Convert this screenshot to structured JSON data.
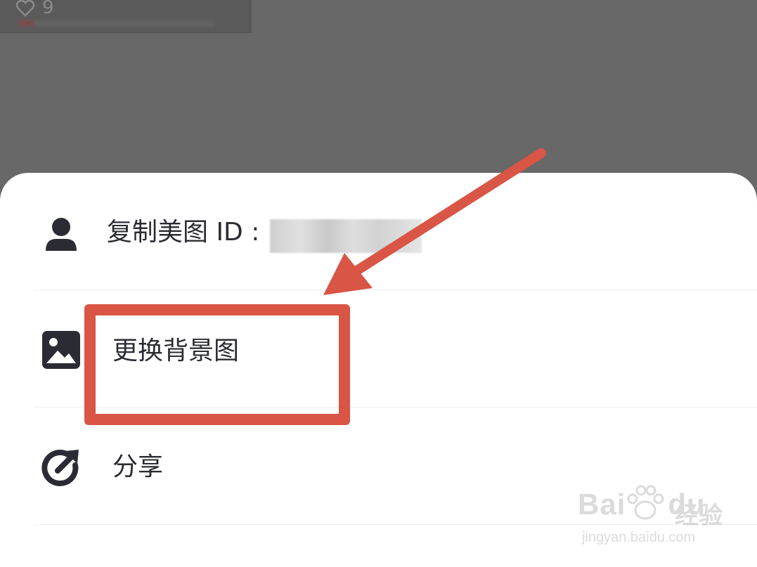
{
  "status_strip": {
    "like_icon": "heart-outline-icon",
    "like_count": "9"
  },
  "menu": {
    "items": [
      {
        "icon": "user-icon",
        "label": "复制美图 ID :"
      },
      {
        "icon": "image-icon",
        "label": "更换背景图"
      },
      {
        "icon": "share-icon",
        "label": "分享"
      }
    ]
  },
  "annotation": {
    "color": "#d95545",
    "target": "更换背景图"
  },
  "watermark": {
    "brand": "Bai",
    "brand_suffix": "du",
    "product": "经验",
    "url": "jingyan.baidu.com"
  },
  "colors": {
    "overlay": "#686868",
    "sheet_bg": "#ffffff",
    "text": "#2b2c33",
    "icon": "#2b2c33",
    "annotation": "#d95545"
  }
}
